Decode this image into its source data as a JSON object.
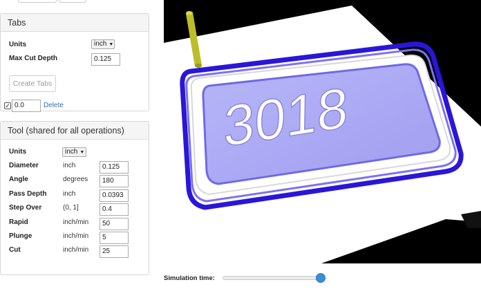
{
  "tabs_panel": {
    "title": "Tabs",
    "units_label": "Units",
    "units_value": "inch",
    "max_cut_depth_label": "Max Cut Depth",
    "max_cut_depth_value": "0.125",
    "create_tabs_label": "Create Tabs",
    "tab_row": {
      "checked": true,
      "value": "0.0",
      "delete_label": "Delete"
    }
  },
  "tool_panel": {
    "title": "Tool (shared for all operations)",
    "units_label": "Units",
    "units_value": "inch",
    "rows": [
      {
        "label": "Diameter",
        "unit": "inch",
        "value": "0.125"
      },
      {
        "label": "Angle",
        "unit": "degrees",
        "value": "180"
      },
      {
        "label": "Pass Depth",
        "unit": "inch",
        "value": "0.0393"
      },
      {
        "label": "Step Over",
        "unit": "(0, 1]",
        "value": "0.4"
      },
      {
        "label": "Rapid",
        "unit": "inch/min",
        "value": "50"
      },
      {
        "label": "Plunge",
        "unit": "inch/min",
        "value": "5"
      },
      {
        "label": "Cut",
        "unit": "inch/min",
        "value": "25"
      }
    ]
  },
  "viewport": {
    "engraved_text": "3018",
    "colors": {
      "background": "#000000",
      "stock": "#ffffff",
      "pocket": "#aaa8f4",
      "pocket_edge": "#2a16d8",
      "tool": "#bdbd2a"
    }
  },
  "simulation": {
    "label": "Simulation time:",
    "progress": 1.0
  }
}
